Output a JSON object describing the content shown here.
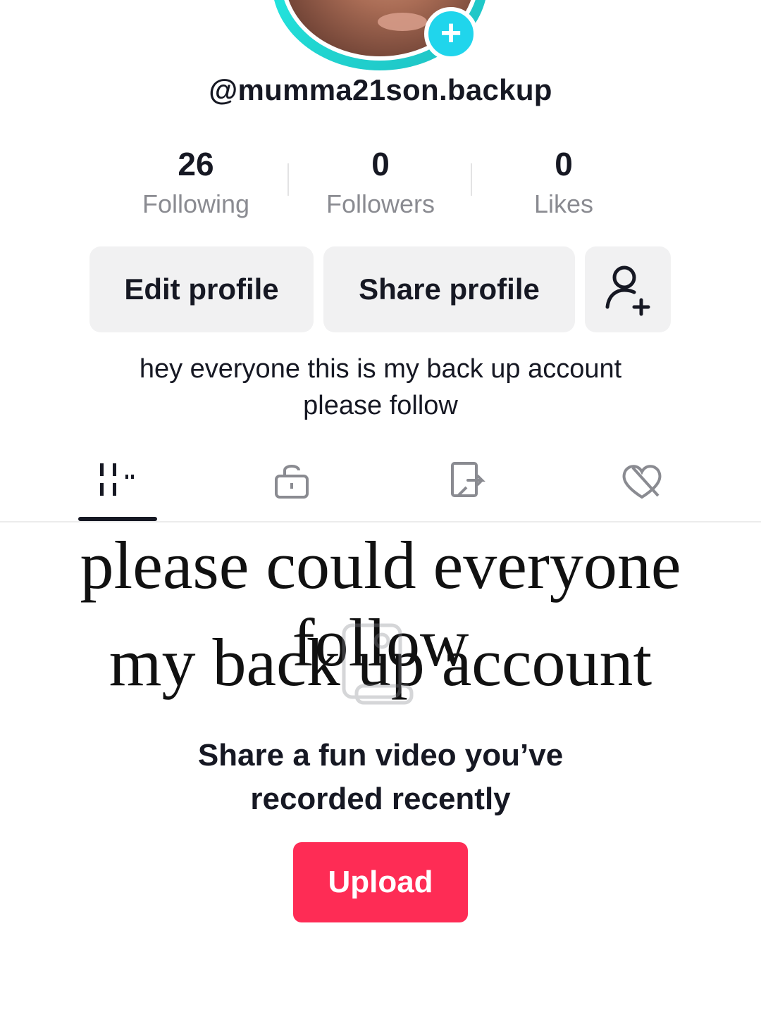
{
  "profile": {
    "username": "@mumma21son.backup",
    "stats": [
      {
        "value": "26",
        "label": "Following"
      },
      {
        "value": "0",
        "label": "Followers"
      },
      {
        "value": "0",
        "label": "Likes"
      }
    ],
    "buttons": {
      "edit": "Edit profile",
      "share": "Share profile",
      "add_friends_icon": "add-person-icon"
    },
    "bio": {
      "line1": "hey everyone this is my back up account",
      "line2": "please follow"
    }
  },
  "tabs": [
    {
      "icon": "videos-grid-icon",
      "active": true
    },
    {
      "icon": "locked-icon",
      "active": false
    },
    {
      "icon": "reposts-icon",
      "active": false
    },
    {
      "icon": "liked-hidden-icon",
      "active": false
    }
  ],
  "overlay_caption": {
    "line1": "please could everyone follow",
    "line2": "my back up account"
  },
  "empty_state": {
    "icon": "phone-upload-icon",
    "prompt_line1": "Share a fun video you’ve",
    "prompt_line2": "recorded recently",
    "upload_label": "Upload"
  },
  "colors": {
    "accent_cyan": "#20d5ec",
    "upload_red": "#fe2c55",
    "button_gray": "#f1f1f2",
    "secondary_text": "#8a8b91"
  }
}
